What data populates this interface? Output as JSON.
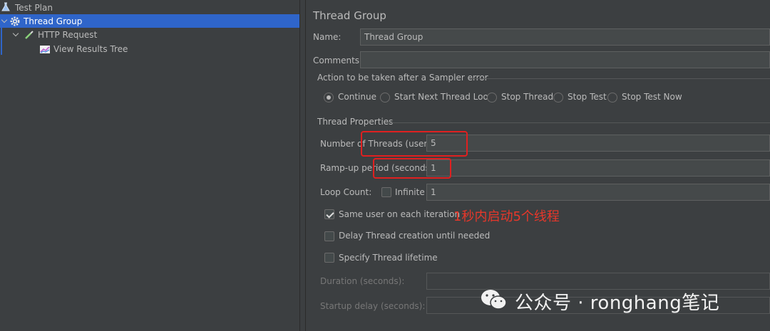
{
  "tree": {
    "items": [
      {
        "label": "Test Plan",
        "icon": "flask-icon"
      },
      {
        "label": "Thread Group",
        "icon": "gear-icon"
      },
      {
        "label": "HTTP Request",
        "icon": "pipette-icon"
      },
      {
        "label": "View Results Tree",
        "icon": "chart-icon"
      }
    ],
    "selected_index": 1
  },
  "form": {
    "title": "Thread Group",
    "name_label": "Name:",
    "name_value": "Thread Group",
    "comments_label": "Comments:",
    "comments_value": "",
    "sampler_error": {
      "legend": "Action to be taken after a Sampler error",
      "options": [
        "Continue",
        "Start Next Thread Loop",
        "Stop Thread",
        "Stop Test",
        "Stop Test Now"
      ],
      "selected": "Continue"
    },
    "thread_props": {
      "legend": "Thread Properties",
      "threads_label": "Number of Threads (users):",
      "threads_value": "5",
      "rampup_label": "Ramp-up period (seconds):",
      "rampup_value": "1",
      "loop_label": "Loop Count:",
      "infinite_label": "Infinite",
      "infinite_checked": false,
      "loop_value": "1",
      "same_user_label": "Same user on each iteration",
      "same_user_checked": true,
      "delay_label": "Delay Thread creation until needed",
      "delay_checked": false,
      "lifetime_label": "Specify Thread lifetime",
      "lifetime_checked": false,
      "duration_label": "Duration (seconds):",
      "duration_value": "",
      "startup_label": "Startup delay (seconds):",
      "startup_value": ""
    }
  },
  "annotation": {
    "text": "1秒内启动5个线程",
    "color": "#e8372a"
  },
  "watermark": {
    "text": "公众号 · ronghang笔记",
    "icon": "wechat-icon"
  },
  "colors": {
    "background": "#3c3f41",
    "selection": "#2f65ca",
    "highlight_box": "#e02020"
  }
}
